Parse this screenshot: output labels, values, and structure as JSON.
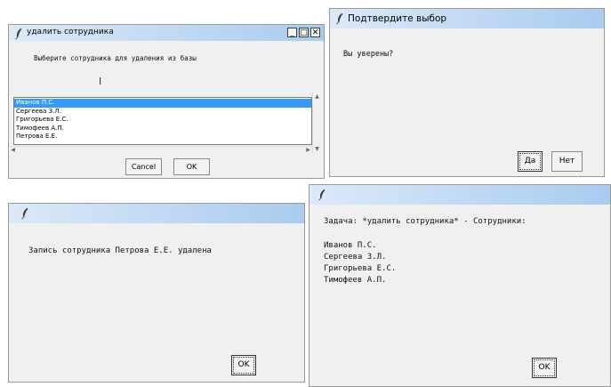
{
  "window_delete": {
    "title": "удалить сотрудника",
    "prompt": "Выберите сотрудника для удаления из базы",
    "employees": [
      "Иванов П.С.",
      "Сергеева З.Л.",
      "Григорьева Е.С.",
      "Тимофеев А.П.",
      "Петрова Е.Е."
    ],
    "selected_index": 0,
    "cancel_label": "Cancel",
    "ok_label": "OK",
    "minimize_glyph": "_",
    "maximize_glyph": "□",
    "close_glyph": "✕"
  },
  "window_confirm": {
    "title": "Подтвердите выбор",
    "message": "Вы уверены?",
    "yes_label": "Да",
    "no_label": "Нет"
  },
  "window_deleted": {
    "title": "",
    "message": "Запись сотрудника Петрова Е.Е. удалена",
    "ok_label": "OK"
  },
  "window_result": {
    "title": "",
    "task_line": "Задача: *удалить сотрудника*  - Сотрудники:",
    "employees": [
      "Иванов П.С.",
      "Сергеева З.Л.",
      "Григорьева Е.С.",
      "Тимофеев А.П."
    ],
    "ok_label": "OK"
  },
  "icons": {
    "window_icon": "feather-icon",
    "cursor": "text-cursor-icon"
  }
}
